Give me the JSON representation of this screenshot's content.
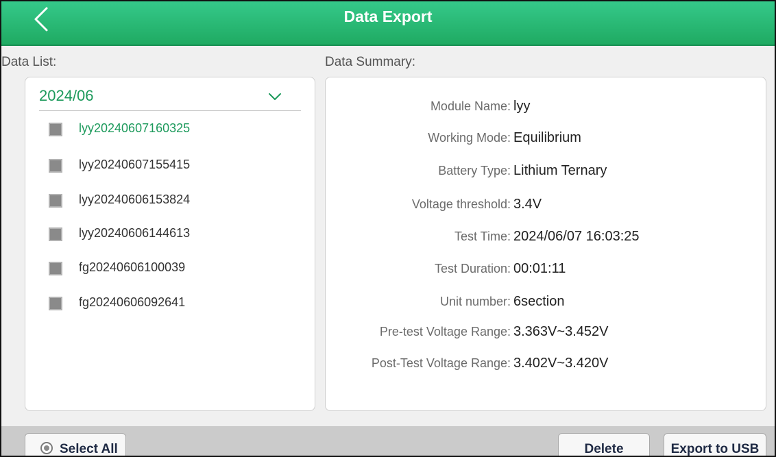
{
  "header": {
    "title": "Data Export",
    "back_icon": "chevron-left-icon"
  },
  "data_list": {
    "label": "Data List:",
    "selected_month": "2024/06",
    "dropdown_icon": "chevron-down-icon",
    "items": [
      {
        "name": "lyy20240607160325",
        "checked": false,
        "active": true
      },
      {
        "name": "lyy20240607155415",
        "checked": false,
        "active": false
      },
      {
        "name": "lyy20240606153824",
        "checked": false,
        "active": false
      },
      {
        "name": "lyy20240606144613",
        "checked": false,
        "active": false
      },
      {
        "name": "fg20240606100039",
        "checked": false,
        "active": false
      },
      {
        "name": "fg20240606092641",
        "checked": false,
        "active": false
      }
    ]
  },
  "summary": {
    "label": "Data Summary:",
    "rows": [
      {
        "label": "Module Name:",
        "value": "lyy"
      },
      {
        "label": "Working Mode:",
        "value": "Equilibrium"
      },
      {
        "label": "Battery Type:",
        "value": "Lithium Ternary"
      },
      {
        "label": "Voltage threshold:",
        "value": "3.4V"
      },
      {
        "label": "Test Time:",
        "value": "2024/06/07 16:03:25"
      },
      {
        "label": "Test Duration:",
        "value": "00:01:11"
      },
      {
        "label": "Unit number:",
        "value": "6section"
      },
      {
        "label": "Pre-test Voltage Range:",
        "value": "3.363V~3.452V"
      },
      {
        "label": "Post-Test Voltage Range:",
        "value": "3.402V~3.420V"
      }
    ]
  },
  "footer": {
    "select_all_label": "Select All",
    "delete_label": "Delete",
    "export_label": "Export to USB"
  },
  "colors": {
    "header_green": "#1faa62",
    "accent_green": "#1d9a5c",
    "checkbox_gray": "#8a8a8a",
    "footer_gray": "#cbcbcb"
  }
}
